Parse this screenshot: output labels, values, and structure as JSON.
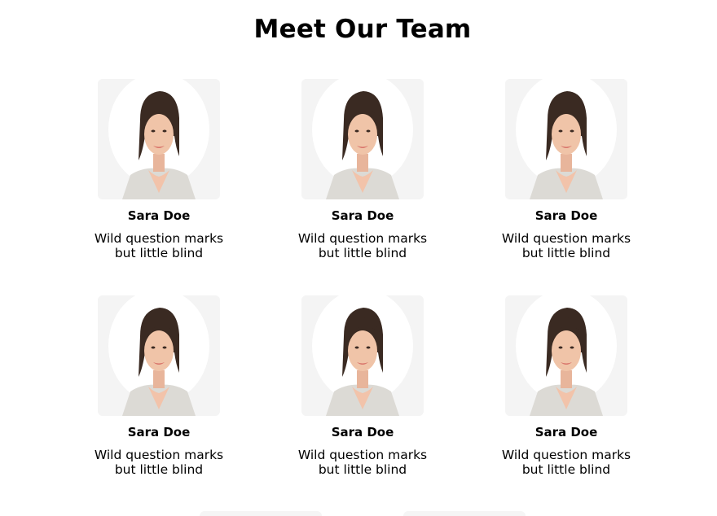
{
  "page": {
    "title": "Meet Our Team"
  },
  "team": [
    {
      "name": "Sara Doe",
      "desc_line1": "Wild question marks",
      "desc_line2": "but little blind"
    },
    {
      "name": "Sara Doe",
      "desc_line1": "Wild question marks",
      "desc_line2": "but little blind"
    },
    {
      "name": "Sara Doe",
      "desc_line1": "Wild question marks",
      "desc_line2": "but little blind"
    },
    {
      "name": "Sara Doe",
      "desc_line1": "Wild question marks",
      "desc_line2": "but little blind"
    },
    {
      "name": "Sara Doe",
      "desc_line1": "Wild question marks",
      "desc_line2": "but little blind"
    },
    {
      "name": "Sara Doe",
      "desc_line1": "Wild question marks",
      "desc_line2": "but little blind"
    }
  ],
  "colors": {
    "background": "#ffffff",
    "text": "#000000",
    "photo_background": "#f4f4f4"
  }
}
